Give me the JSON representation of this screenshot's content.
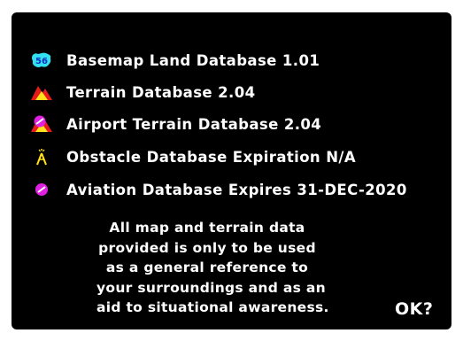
{
  "databases": [
    {
      "label": "Basemap Land Database 1.01",
      "icon": "basemap-land-icon"
    },
    {
      "label": "Terrain Database 2.04",
      "icon": "terrain-icon"
    },
    {
      "label": "Airport Terrain Database 2.04",
      "icon": "airport-terrain-icon"
    },
    {
      "label": "Obstacle Database Expiration N/A",
      "icon": "obstacle-icon"
    },
    {
      "label": "Aviation Database Expires 31-DEC-2020",
      "icon": "aviation-icon"
    }
  ],
  "notice": {
    "lines": [
      "All map and terrain data",
      "provided is only to be used",
      "as a general reference to",
      "your surroundings and as an",
      "aid to situational awareness."
    ]
  },
  "ok_label": "OK?",
  "colors": {
    "background": "#000000",
    "text": "#ffffff",
    "basemap_cyan": "#33e0f0",
    "terrain_red": "#e81b1b",
    "terrain_yellow": "#ffe21a",
    "aviation_magenta": "#e020e0"
  }
}
